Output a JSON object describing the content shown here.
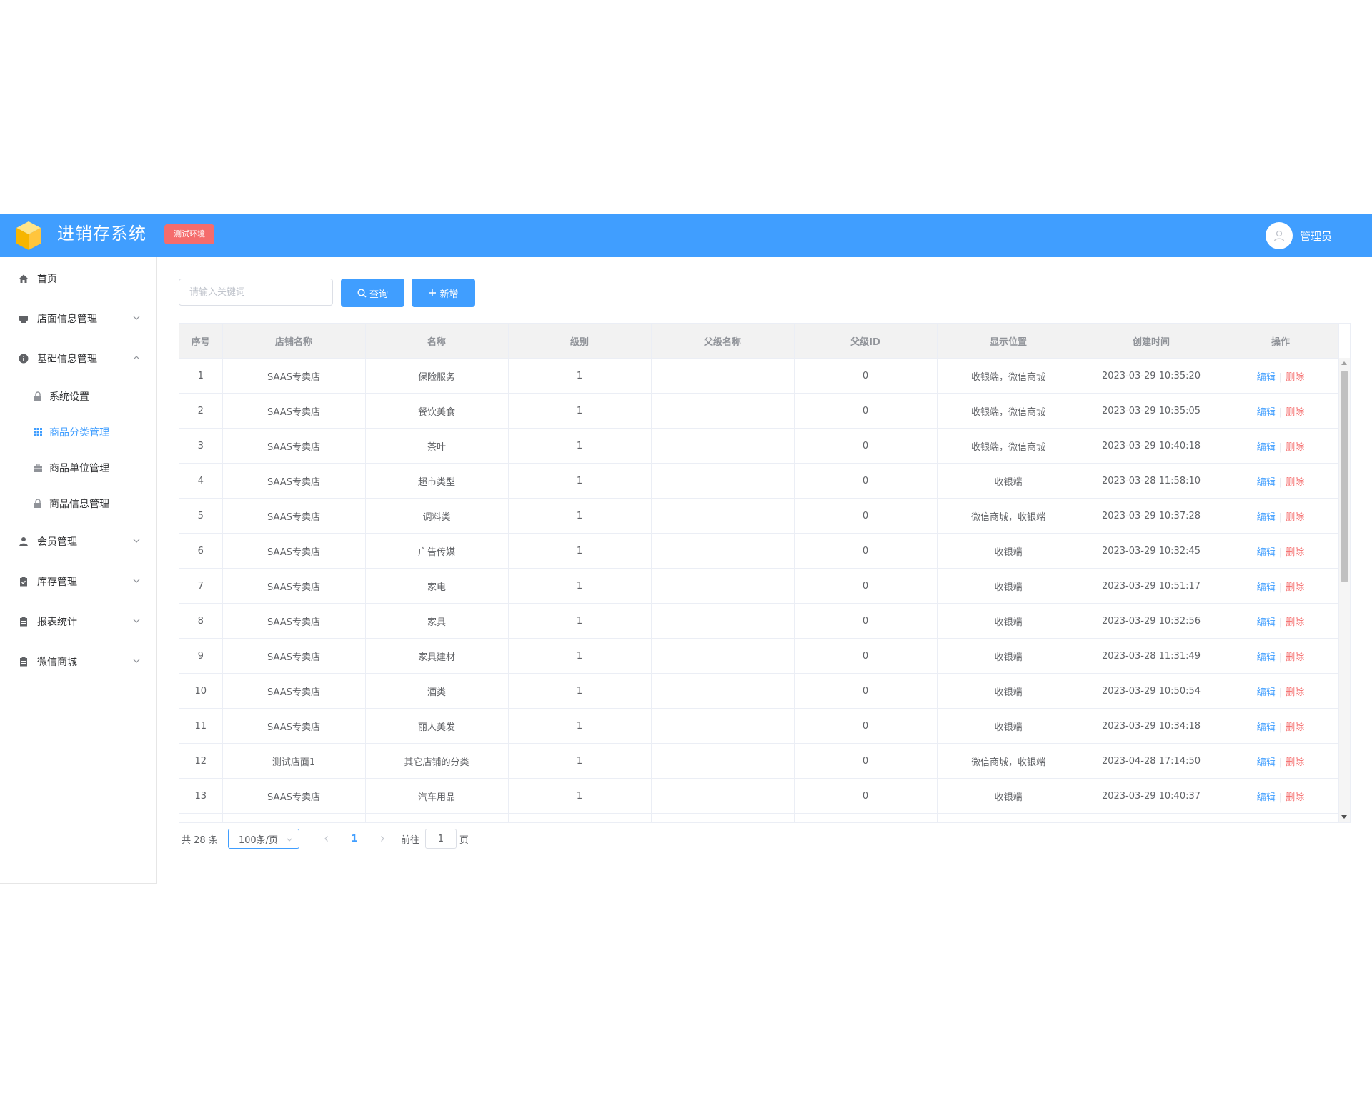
{
  "header": {
    "app_title": "进销存系统",
    "env_badge": "测试环境",
    "user_name": "管理员",
    "bg_color": "#409eff"
  },
  "sidebar": {
    "home": "首页",
    "store_info": "店面信息管理",
    "basic_info": "基础信息管理",
    "basic_sub": {
      "system_settings": "系统设置",
      "category_mgmt": "商品分类管理",
      "unit_mgmt": "商品单位管理",
      "product_info": "商品信息管理"
    },
    "member_mgmt": "会员管理",
    "inventory_mgmt": "库存管理",
    "reports": "报表统计",
    "wechat_mall": "微信商城",
    "active_color": "#409eff"
  },
  "toolbar": {
    "search_placeholder": "请输入关键词",
    "search_value": "",
    "query_label": "查询",
    "add_label": "新增"
  },
  "table": {
    "columns": [
      "序号",
      "店铺名称",
      "名称",
      "级别",
      "父级名称",
      "父级ID",
      "显示位置",
      "创建时间",
      "操作"
    ],
    "edit_label": "编辑",
    "delete_label": "删除",
    "rows": [
      [
        "1",
        "SAAS专卖店",
        "保险服务",
        "1",
        "",
        "0",
        "收银端，微信商城",
        "2023-03-29 10:35:20"
      ],
      [
        "2",
        "SAAS专卖店",
        "餐饮美食",
        "1",
        "",
        "0",
        "收银端，微信商城",
        "2023-03-29 10:35:05"
      ],
      [
        "3",
        "SAAS专卖店",
        "茶叶",
        "1",
        "",
        "0",
        "收银端，微信商城",
        "2023-03-29 10:40:18"
      ],
      [
        "4",
        "SAAS专卖店",
        "超市类型",
        "1",
        "",
        "0",
        "收银端",
        "2023-03-28 11:58:10"
      ],
      [
        "5",
        "SAAS专卖店",
        "调料类",
        "1",
        "",
        "0",
        "微信商城，收银端",
        "2023-03-29 10:37:28"
      ],
      [
        "6",
        "SAAS专卖店",
        "广告传媒",
        "1",
        "",
        "0",
        "收银端",
        "2023-03-29 10:32:45"
      ],
      [
        "7",
        "SAAS专卖店",
        "家电",
        "1",
        "",
        "0",
        "收银端",
        "2023-03-29 10:51:17"
      ],
      [
        "8",
        "SAAS专卖店",
        "家具",
        "1",
        "",
        "0",
        "收银端",
        "2023-03-29 10:32:56"
      ],
      [
        "9",
        "SAAS专卖店",
        "家具建材",
        "1",
        "",
        "0",
        "收银端",
        "2023-03-28 11:31:49"
      ],
      [
        "10",
        "SAAS专卖店",
        "酒类",
        "1",
        "",
        "0",
        "收银端",
        "2023-03-29 10:50:54"
      ],
      [
        "11",
        "SAAS专卖店",
        "丽人美发",
        "1",
        "",
        "0",
        "收银端",
        "2023-03-29 10:34:18"
      ],
      [
        "12",
        "测试店面1",
        "其它店铺的分类",
        "1",
        "",
        "0",
        "微信商城，收银端",
        "2023-04-28 17:14:50"
      ],
      [
        "13",
        "SAAS专卖店",
        "汽车用品",
        "1",
        "",
        "0",
        "收银端",
        "2023-03-29 10:40:37"
      ],
      [
        "",
        "",
        "",
        "",
        "",
        "",
        "",
        ""
      ]
    ]
  },
  "pagination": {
    "total_text": "共 28 条",
    "page_size": "100条/页",
    "current_page": "1",
    "goto_prefix": "前往",
    "goto_value": "1",
    "goto_suffix": "页"
  }
}
